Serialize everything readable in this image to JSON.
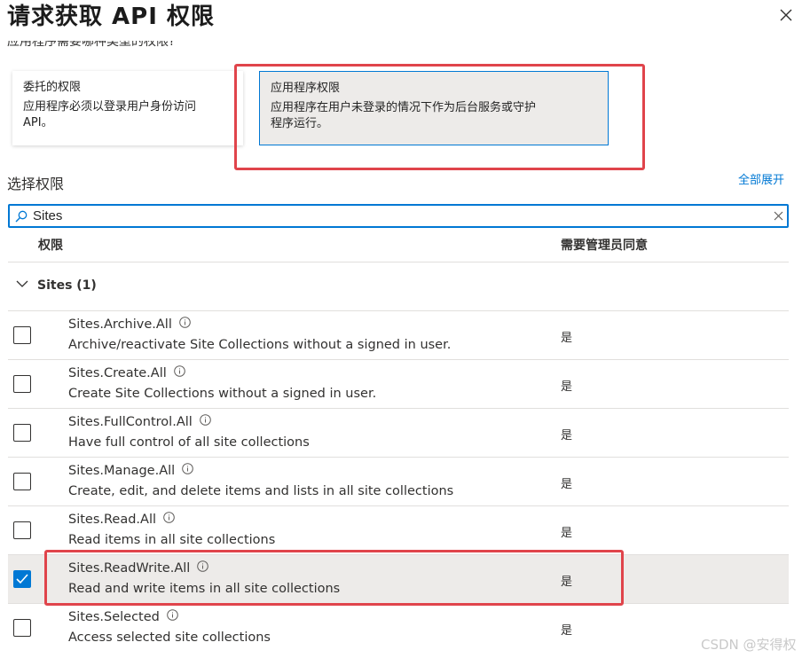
{
  "dialog": {
    "title": "请求获取 API 权限",
    "clipped_question": "应用程序需要哪种类型的权限?"
  },
  "permission_types": [
    {
      "title": "委托的权限",
      "description": "应用程序必须以登录用户身份访问API。",
      "selected": false
    },
    {
      "title": "应用程序权限",
      "description": "应用程序在用户未登录的情况下作为后台服务或守护程序运行。",
      "selected": true
    }
  ],
  "select_permissions": {
    "label": "选择权限",
    "expand_all": "全部展开"
  },
  "search": {
    "value": "Sites",
    "placeholder": ""
  },
  "table": {
    "col_permission": "权限",
    "col_admin_consent": "需要管理员同意"
  },
  "group": {
    "label": "Sites (1)",
    "expanded": true
  },
  "permissions": [
    {
      "name": "Sites.Archive.All",
      "description": "Archive/reactivate Site Collections without a signed in user.",
      "admin_consent": "是",
      "checked": false
    },
    {
      "name": "Sites.Create.All",
      "description": "Create Site Collections without a signed in user.",
      "admin_consent": "是",
      "checked": false
    },
    {
      "name": "Sites.FullControl.All",
      "description": "Have full control of all site collections",
      "admin_consent": "是",
      "checked": false
    },
    {
      "name": "Sites.Manage.All",
      "description": "Create, edit, and delete items and lists in all site collections",
      "admin_consent": "是",
      "checked": false
    },
    {
      "name": "Sites.Read.All",
      "description": "Read items in all site collections",
      "admin_consent": "是",
      "checked": false
    },
    {
      "name": "Sites.ReadWrite.All",
      "description": "Read and write items in all site collections",
      "admin_consent": "是",
      "checked": true
    },
    {
      "name": "Sites.Selected",
      "description": "Access selected site collections",
      "admin_consent": "是",
      "checked": false
    }
  ],
  "watermark": "CSDN @安得权",
  "colors": {
    "accent": "#0078d4",
    "highlight_box": "#e0444b",
    "selected_bg": "#edebe9"
  }
}
